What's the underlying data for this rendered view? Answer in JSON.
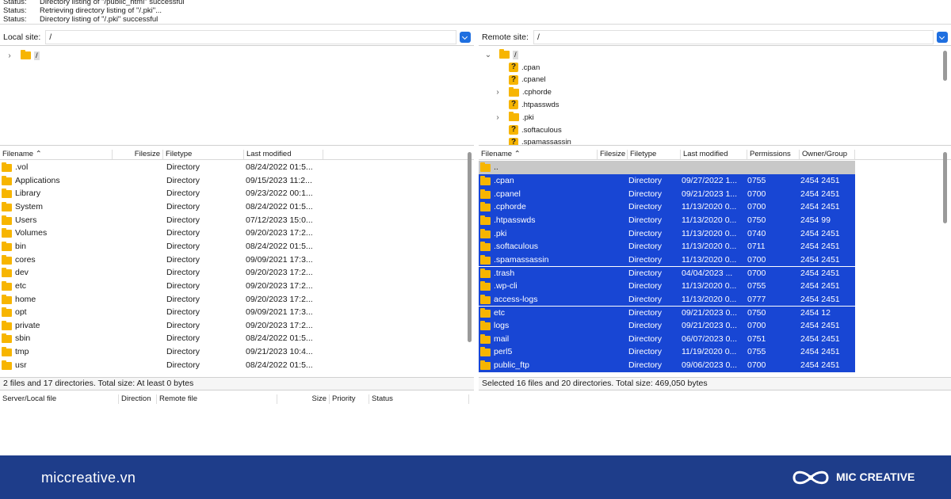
{
  "log": [
    {
      "label": "Status:",
      "text": "Directory listing of \"/public_html\" successful"
    },
    {
      "label": "Status:",
      "text": "Retrieving directory listing of \"/.pki\"..."
    },
    {
      "label": "Status:",
      "text": "Directory listing of \"/.pki\" successful"
    }
  ],
  "local": {
    "site_label": "Local site:",
    "path": "/",
    "tree_root": "/",
    "headers": {
      "filename": "Filename",
      "filesize": "Filesize",
      "filetype": "Filetype",
      "modified": "Last modified"
    },
    "files": [
      {
        "name": ".vol",
        "type": "Directory",
        "modified": "08/24/2022 01:5..."
      },
      {
        "name": "Applications",
        "type": "Directory",
        "modified": "09/15/2023 11:2..."
      },
      {
        "name": "Library",
        "type": "Directory",
        "modified": "09/23/2022 00:1..."
      },
      {
        "name": "System",
        "type": "Directory",
        "modified": "08/24/2022 01:5..."
      },
      {
        "name": "Users",
        "type": "Directory",
        "modified": "07/12/2023 15:0..."
      },
      {
        "name": "Volumes",
        "type": "Directory",
        "modified": "09/20/2023 17:2..."
      },
      {
        "name": "bin",
        "type": "Directory",
        "modified": "08/24/2022 01:5..."
      },
      {
        "name": "cores",
        "type": "Directory",
        "modified": "09/09/2021 17:3..."
      },
      {
        "name": "dev",
        "type": "Directory",
        "modified": "09/20/2023 17:2..."
      },
      {
        "name": "etc",
        "type": "Directory",
        "modified": "09/20/2023 17:2..."
      },
      {
        "name": "home",
        "type": "Directory",
        "modified": "09/20/2023 17:2..."
      },
      {
        "name": "opt",
        "type": "Directory",
        "modified": "09/09/2021 17:3..."
      },
      {
        "name": "private",
        "type": "Directory",
        "modified": "09/20/2023 17:2..."
      },
      {
        "name": "sbin",
        "type": "Directory",
        "modified": "08/24/2022 01:5..."
      },
      {
        "name": "tmp",
        "type": "Directory",
        "modified": "09/21/2023 10:4..."
      },
      {
        "name": "usr",
        "type": "Directory",
        "modified": "08/24/2022 01:5..."
      }
    ],
    "status": "2 files and 17 directories. Total size: At least 0 bytes"
  },
  "remote": {
    "site_label": "Remote site:",
    "path": "/",
    "tree_root": "/",
    "tree": [
      {
        "name": ".cpan",
        "icon": "question-folder",
        "expand": ""
      },
      {
        "name": ".cpanel",
        "icon": "question-folder",
        "expand": ""
      },
      {
        "name": ".cphorde",
        "icon": "folder",
        "expand": "›"
      },
      {
        "name": ".htpasswds",
        "icon": "question-folder",
        "expand": ""
      },
      {
        "name": ".pki",
        "icon": "folder",
        "expand": "›"
      },
      {
        "name": ".softaculous",
        "icon": "question-folder",
        "expand": ""
      },
      {
        "name": ".spamassassin",
        "icon": "question-folder",
        "expand": ""
      }
    ],
    "headers": {
      "filename": "Filename",
      "filesize": "Filesize",
      "filetype": "Filetype",
      "modified": "Last modified",
      "permissions": "Permissions",
      "owner": "Owner/Group"
    },
    "parent": "..",
    "files": [
      {
        "name": ".cpan",
        "type": "Directory",
        "modified": "09/27/2022 1...",
        "perm": "0755",
        "owner": "2454 2451"
      },
      {
        "name": ".cpanel",
        "type": "Directory",
        "modified": "09/21/2023 1...",
        "perm": "0700",
        "owner": "2454 2451"
      },
      {
        "name": ".cphorde",
        "type": "Directory",
        "modified": "11/13/2020 0...",
        "perm": "0700",
        "owner": "2454 2451"
      },
      {
        "name": ".htpasswds",
        "type": "Directory",
        "modified": "11/13/2020 0...",
        "perm": "0750",
        "owner": "2454 99"
      },
      {
        "name": ".pki",
        "type": "Directory",
        "modified": "11/13/2020 0...",
        "perm": "0740",
        "owner": "2454 2451"
      },
      {
        "name": ".softaculous",
        "type": "Directory",
        "modified": "11/13/2020 0...",
        "perm": "0711",
        "owner": "2454 2451"
      },
      {
        "name": ".spamassassin",
        "type": "Directory",
        "modified": "11/13/2020 0...",
        "perm": "0700",
        "owner": "2454 2451"
      },
      {
        "name": ".trash",
        "type": "Directory",
        "modified": "04/04/2023 ...",
        "perm": "0700",
        "owner": "2454 2451"
      },
      {
        "name": ".wp-cli",
        "type": "Directory",
        "modified": "11/13/2020 0...",
        "perm": "0755",
        "owner": "2454 2451"
      },
      {
        "name": "access-logs",
        "type": "Directory",
        "modified": "11/13/2020 0...",
        "perm": "0777",
        "owner": "2454 2451"
      },
      {
        "name": "etc",
        "type": "Directory",
        "modified": "09/21/2023 0...",
        "perm": "0750",
        "owner": "2454 12"
      },
      {
        "name": "logs",
        "type": "Directory",
        "modified": "09/21/2023 0...",
        "perm": "0700",
        "owner": "2454 2451"
      },
      {
        "name": "mail",
        "type": "Directory",
        "modified": "06/07/2023 0...",
        "perm": "0751",
        "owner": "2454 2451"
      },
      {
        "name": "perl5",
        "type": "Directory",
        "modified": "11/19/2020 0...",
        "perm": "0755",
        "owner": "2454 2451"
      },
      {
        "name": "public_ftp",
        "type": "Directory",
        "modified": "09/06/2023 0...",
        "perm": "0700",
        "owner": "2454 2451"
      }
    ],
    "status": "Selected 16 files and 20 directories. Total size: 469,050 bytes"
  },
  "queue": {
    "headers": {
      "server_file": "Server/Local file",
      "direction": "Direction",
      "remote_file": "Remote file",
      "size": "Size",
      "priority": "Priority",
      "status": "Status"
    }
  },
  "footer": {
    "url": "miccreative.vn",
    "brand": "MIC CREATIVE"
  },
  "colors": {
    "selection": "#1846d4",
    "folder": "#f7b500",
    "footer_bg": "#1e3d8a",
    "accent": "#1f6fe0"
  }
}
